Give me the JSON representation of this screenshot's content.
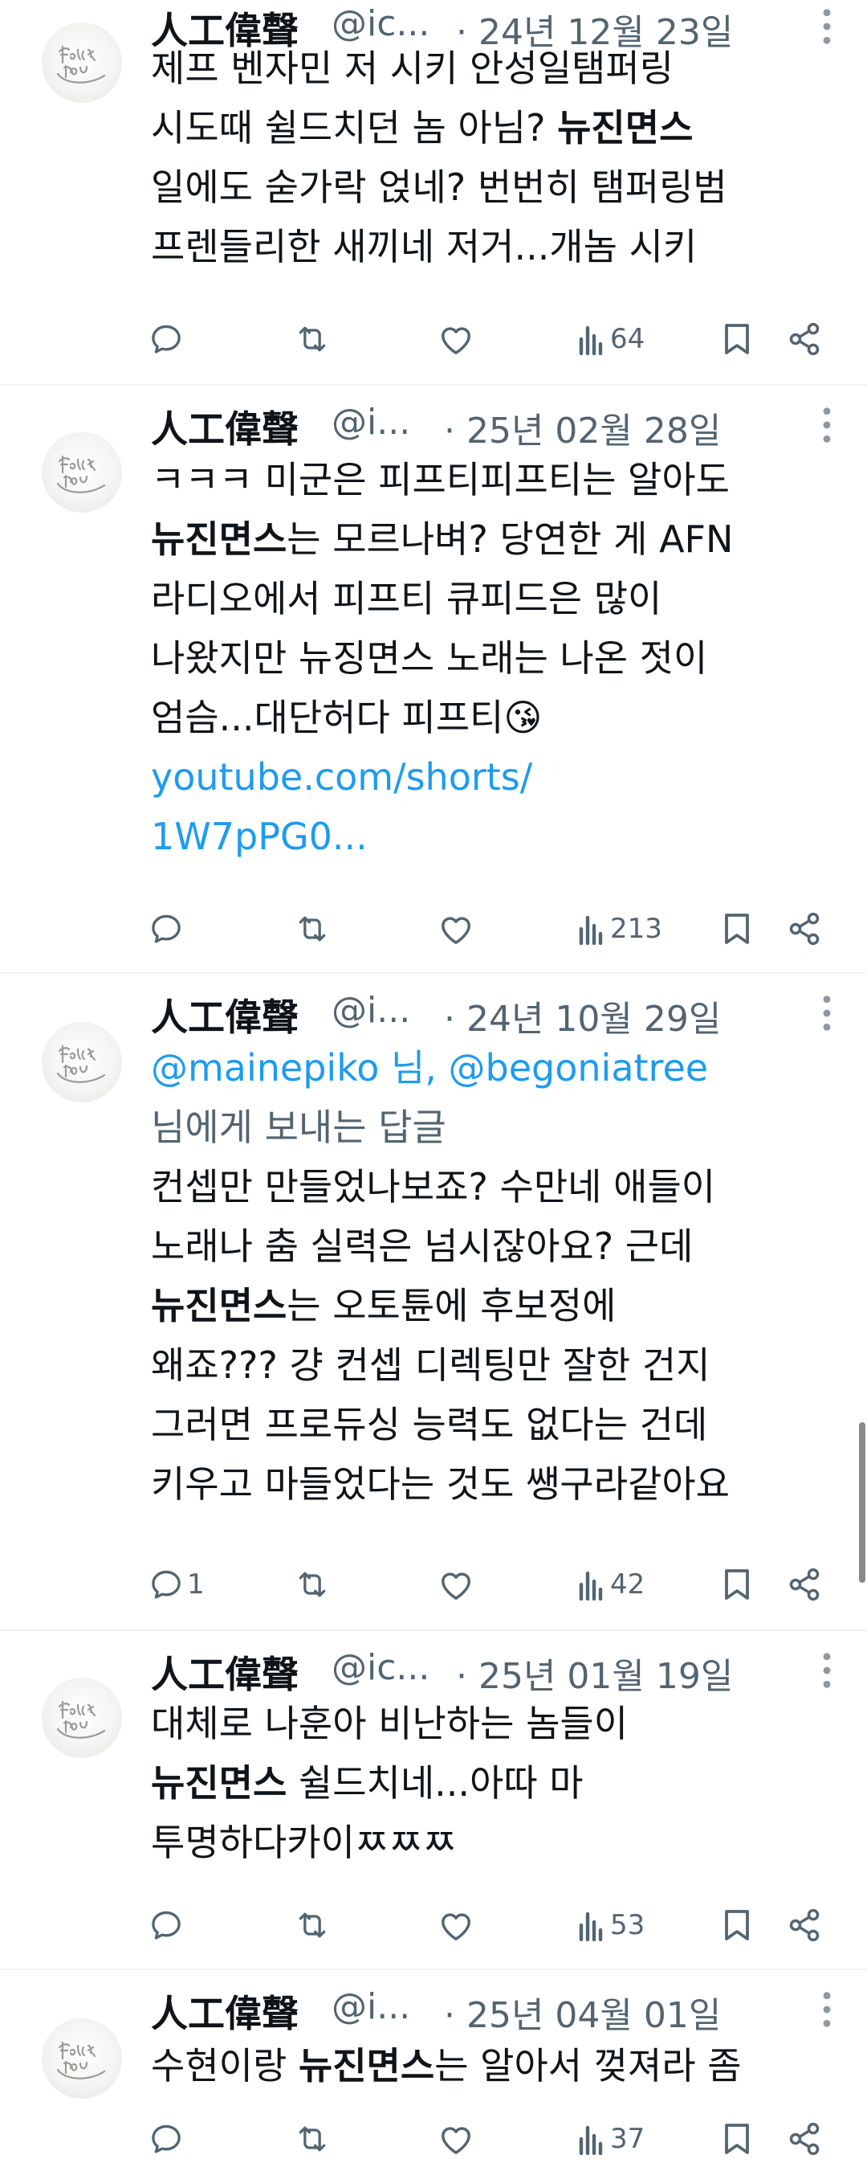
{
  "tweets": [
    {
      "name": "人工偉聲",
      "handle": "@ic...",
      "date": "· 24년 12월 23일",
      "lines": [
        [
          {
            "t": "제프 벤자민 저 시키 안성일탬퍼링"
          }
        ],
        [
          {
            "t": "시도때 쉴드치던 놈 아님? "
          },
          {
            "t": "뉴진면스",
            "b": true
          }
        ],
        [
          {
            "t": "일에도 숟가락 얹네? 번번히  탬퍼링범"
          }
        ],
        [
          {
            "t": "프렌들리한 새끼네 저거...개놈 시키"
          }
        ]
      ],
      "replies": "",
      "views": "64"
    },
    {
      "name": "人工偉聲",
      "handle": "@i...",
      "date": "· 25년 02월 28일",
      "lines": [
        [
          {
            "t": "ㅋㅋㅋ 미군은 피프티피프티는 알아도"
          }
        ],
        [
          {
            "t": "뉴진면스",
            "b": true
          },
          {
            "t": "는 모르나벼? 당연한 게 AFN"
          }
        ],
        [
          {
            "t": "라디오에서 피프티 큐피드은 많이"
          }
        ],
        [
          {
            "t": "나왔지만 뉴징면스 노래는 나온 젓이"
          }
        ],
        [
          {
            "t": "엄슴...대단허다 피프티😘"
          }
        ],
        [
          {
            "t": "youtube.com/shorts/",
            "l": true
          }
        ],
        [
          {
            "t": "1W7pPG0...",
            "l": true
          }
        ]
      ],
      "replies": "",
      "views": "213"
    },
    {
      "name": "人工偉聲",
      "handle": "@i...",
      "date": "· 24년 10월 29일",
      "lines": [
        [
          {
            "t": "@mainepiko 님, @begoniatree",
            "l": true
          }
        ],
        [
          {
            "t": "님에게 보내는 답글",
            "m": true
          }
        ],
        [
          {
            "t": "컨셉만 만들었나보죠? 수만네 애들이"
          }
        ],
        [
          {
            "t": "노래나 춤 실력은 넘시잖아요? 근데"
          }
        ],
        [
          {
            "t": "뉴진면스",
            "b": true
          },
          {
            "t": "는 오토튠에 후보정에"
          }
        ],
        [
          {
            "t": "왜죠??? 걍 컨셉 디렉팅만 잘한 건지"
          }
        ],
        [
          {
            "t": "그러면 프로듀싱 능력도 없다는 건데"
          }
        ],
        [
          {
            "t": "키우고 마들었다는 것도 쌩구라같아요"
          }
        ]
      ],
      "replies": "1",
      "views": "42"
    },
    {
      "name": "人工偉聲",
      "handle": "@ic...",
      "date": "· 25년 01월 19일",
      "lines": [
        [
          {
            "t": "대체로 나훈아 비난하는 놈들이"
          }
        ],
        [
          {
            "t": "뉴진면스",
            "b": true
          },
          {
            "t": " 쉴드치네...아따 마"
          }
        ],
        [
          {
            "t": "투명하다카이ㅉㅉㅉ"
          }
        ]
      ],
      "replies": "",
      "views": "53"
    },
    {
      "name": "人工偉聲",
      "handle": "@i...",
      "date": "· 25년 04월 01일",
      "lines": [
        [
          {
            "t": "수현이랑 "
          },
          {
            "t": "뉴진면스",
            "b": true
          },
          {
            "t": "는 알아서 껒져라 좀"
          }
        ]
      ],
      "replies": "",
      "views": "37"
    }
  ],
  "icons": {
    "reply": "reply-icon",
    "retweet": "retweet-icon",
    "like": "like-icon",
    "views": "views-icon",
    "bookmark": "bookmark-icon",
    "share": "share-icon",
    "more": "more-icon",
    "avatar": "avatar-icon"
  },
  "colors": {
    "link": "#1d9bf0",
    "muted": "#536471",
    "text": "#0f1419"
  }
}
